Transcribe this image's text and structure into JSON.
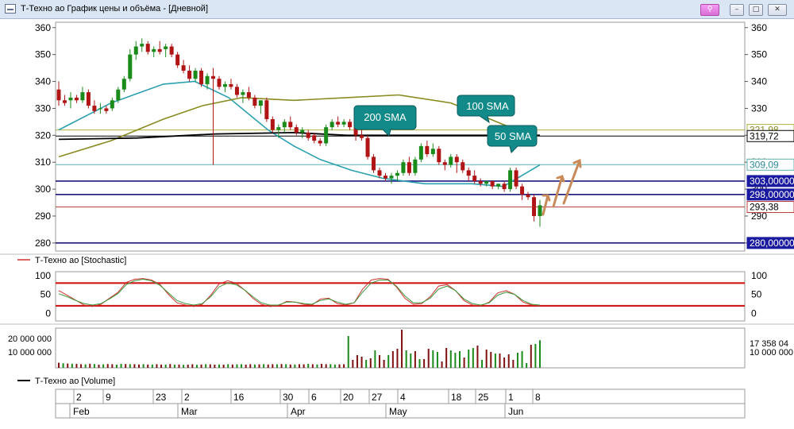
{
  "window": {
    "title": "Т-Техно ао График цены и объёма - [Дневной]",
    "buttons": {
      "pin": "⚲",
      "minimize": "–",
      "maximize": "□",
      "close": "✕"
    }
  },
  "price_pane": {
    "y_ticks": [
      "360",
      "350",
      "340",
      "330",
      "320",
      "310",
      "300",
      "290",
      "280"
    ],
    "labels": {
      "sma200": "200 SMA",
      "sma100": "100 SMA",
      "sma50": "50 SMA"
    },
    "price_tags": [
      "321,98",
      "319,72",
      "309,09",
      "303,00000",
      "298,00000",
      "293,38",
      "280,00000"
    ],
    "colors": {
      "up": "#1a8a1a",
      "down": "#b01414",
      "sma50": "#2aa0b0",
      "sma100": "#8a8a20",
      "sma200": "#000000",
      "level": "#1a1a80",
      "callout": "#138a8a"
    }
  },
  "stochastic_pane": {
    "legend": "Т-Техно ао [Stochastic]",
    "y_ticks": [
      "100",
      "50",
      "0"
    ]
  },
  "volume_pane": {
    "legend": "Т-Техно ао [Volume]",
    "left_ticks": [
      "20 000 000",
      "10 000 000"
    ],
    "right_ticks": [
      "17 358 04",
      "10 000 000"
    ]
  },
  "time_axis": {
    "days": [
      "2",
      "9",
      "23",
      "2",
      "16",
      "30",
      "6",
      "20",
      "27",
      "4",
      "18",
      "25",
      "1",
      "8"
    ],
    "months": [
      "Feb",
      "Mar",
      "Apr",
      "May",
      "Jun"
    ]
  },
  "chart_data": [
    {
      "type": "candlestick",
      "title": "",
      "ylim": [
        277,
        362
      ],
      "yticks": [
        360,
        350,
        340,
        330,
        320,
        310,
        300,
        290,
        280
      ],
      "ohlc": [
        [
          337,
          340,
          331,
          333
        ],
        [
          333,
          335,
          331,
          332
        ],
        [
          333,
          336,
          330,
          334
        ],
        [
          334,
          335,
          332,
          333
        ],
        [
          333,
          338,
          332,
          336
        ],
        [
          336,
          337,
          330,
          331
        ],
        [
          331,
          333,
          328,
          329
        ],
        [
          330,
          332,
          328,
          330
        ],
        [
          330,
          331,
          328,
          329
        ],
        [
          330,
          334,
          329,
          333
        ],
        [
          333,
          338,
          332,
          337
        ],
        [
          337,
          342,
          336,
          341
        ],
        [
          341,
          352,
          340,
          350
        ],
        [
          350,
          355,
          348,
          353
        ],
        [
          353,
          356,
          351,
          354
        ],
        [
          354,
          355,
          350,
          351
        ],
        [
          351,
          353,
          349,
          352
        ],
        [
          352,
          355,
          350,
          351
        ],
        [
          352,
          354,
          349,
          353
        ],
        [
          353,
          354,
          349,
          350
        ],
        [
          350,
          351,
          345,
          346
        ],
        [
          346,
          348,
          343,
          344
        ],
        [
          344,
          346,
          340,
          341
        ],
        [
          341,
          345,
          340,
          344
        ],
        [
          344,
          345,
          338,
          339
        ],
        [
          339,
          343,
          337,
          342
        ],
        [
          342,
          345,
          309,
          341
        ],
        [
          341,
          342,
          337,
          338
        ],
        [
          338,
          340,
          336,
          339
        ],
        [
          339,
          341,
          337,
          338
        ],
        [
          338,
          339,
          334,
          335
        ],
        [
          335,
          337,
          332,
          336
        ],
        [
          336,
          338,
          333,
          334
        ],
        [
          334,
          335,
          330,
          331
        ],
        [
          331,
          333,
          328,
          333
        ],
        [
          333,
          334,
          325,
          326
        ],
        [
          326,
          327,
          321,
          322
        ],
        [
          322,
          324,
          319,
          323
        ],
        [
          323,
          326,
          321,
          325
        ],
        [
          325,
          327,
          322,
          323
        ],
        [
          323,
          324,
          320,
          321
        ],
        [
          321,
          323,
          319,
          322
        ],
        [
          321,
          322,
          318,
          319
        ],
        [
          320,
          321,
          317,
          318
        ],
        [
          318,
          319,
          316,
          317
        ],
        [
          317,
          324,
          316,
          323
        ],
        [
          323,
          326,
          322,
          325
        ],
        [
          325,
          327,
          323,
          324
        ],
        [
          324,
          326,
          323,
          325
        ],
        [
          325,
          326,
          322,
          323
        ],
        [
          323,
          324,
          318,
          320
        ],
        [
          320,
          322,
          318,
          319
        ],
        [
          319,
          320,
          311,
          312
        ],
        [
          312,
          313,
          306,
          307
        ],
        [
          307,
          308,
          304,
          305
        ],
        [
          305,
          306,
          303,
          304
        ],
        [
          304,
          306,
          302,
          305
        ],
        [
          305,
          307,
          303,
          306
        ],
        [
          306,
          311,
          305,
          310
        ],
        [
          310,
          312,
          305,
          306
        ],
        [
          306,
          312,
          305,
          311
        ],
        [
          311,
          317,
          310,
          316
        ],
        [
          316,
          318,
          312,
          313
        ],
        [
          313,
          317,
          312,
          315
        ],
        [
          315,
          316,
          309,
          310
        ],
        [
          310,
          311,
          307,
          309
        ],
        [
          309,
          313,
          308,
          312
        ],
        [
          312,
          313,
          306,
          310
        ],
        [
          310,
          311,
          306,
          307
        ],
        [
          307,
          308,
          303,
          305
        ],
        [
          305,
          307,
          302,
          303
        ],
        [
          303,
          304,
          301,
          302
        ],
        [
          302,
          303,
          301,
          303
        ],
        [
          303,
          303,
          300,
          301
        ],
        [
          301,
          302,
          300,
          302
        ],
        [
          302,
          303,
          299,
          300
        ],
        [
          300,
          308,
          299,
          307
        ],
        [
          307,
          308,
          300,
          301
        ],
        [
          301,
          302,
          296,
          298
        ],
        [
          298,
          299,
          296,
          297
        ],
        [
          297,
          298,
          288,
          290
        ],
        [
          290,
          296,
          286,
          294
        ]
      ],
      "sma50": [
        [
          0,
          322
        ],
        [
          20,
          332
        ],
        [
          40,
          339
        ],
        [
          52,
          340
        ],
        [
          65,
          334
        ],
        [
          80,
          322
        ],
        [
          90,
          316
        ],
        [
          100,
          311
        ],
        [
          112,
          307
        ],
        [
          124,
          304
        ],
        [
          140,
          302
        ],
        [
          158,
          302
        ],
        [
          170,
          301
        ],
        [
          184,
          309
        ]
      ],
      "sma100": [
        [
          0,
          312
        ],
        [
          20,
          318
        ],
        [
          40,
          326
        ],
        [
          55,
          331
        ],
        [
          70,
          334
        ],
        [
          90,
          333
        ],
        [
          110,
          334
        ],
        [
          130,
          335
        ],
        [
          150,
          332
        ],
        [
          175,
          322
        ]
      ],
      "sma200": [
        [
          0,
          318.5
        ],
        [
          30,
          319
        ],
        [
          60,
          320.5
        ],
        [
          90,
          321
        ],
        [
          110,
          320
        ],
        [
          130,
          320
        ],
        [
          160,
          320
        ],
        [
          184,
          320
        ]
      ],
      "levels": [
        321.98,
        319.72,
        309.09,
        303,
        298,
        293.38,
        280
      ]
    },
    {
      "type": "line",
      "title": "Т-Техно ао [Stochastic]",
      "ylim": [
        -20,
        110
      ],
      "bands": [
        80,
        20
      ],
      "series": [
        {
          "values": [
            60,
            48,
            35,
            22,
            18,
            24,
            40,
            55,
            82,
            90,
            92,
            88,
            76,
            50,
            28,
            22,
            18,
            24,
            48,
            78,
            86,
            80,
            62,
            40,
            24,
            18,
            20,
            32,
            30,
            24,
            22,
            38,
            40,
            26,
            22,
            28,
            64,
            88,
            92,
            90,
            70,
            40,
            24,
            26,
            44,
            72,
            76,
            60,
            34,
            22,
            20,
            30,
            54,
            60,
            50,
            30,
            22,
            20
          ]
        },
        {
          "values": [
            52,
            44,
            34,
            26,
            22,
            26,
            38,
            52,
            76,
            86,
            90,
            86,
            74,
            54,
            34,
            26,
            22,
            26,
            44,
            70,
            80,
            76,
            62,
            44,
            28,
            22,
            22,
            30,
            30,
            26,
            24,
            34,
            38,
            30,
            24,
            28,
            56,
            80,
            88,
            88,
            72,
            46,
            28,
            28,
            40,
            64,
            72,
            60,
            38,
            26,
            22,
            28,
            48,
            56,
            50,
            34,
            24,
            22
          ]
        }
      ]
    },
    {
      "type": "bar",
      "title": "Т-Техно ао [Volume]",
      "ylim": [
        0,
        24000000
      ],
      "values": [
        3200000,
        2900000,
        2700000,
        2600000,
        2500000,
        2300000,
        2200000,
        2600000,
        2400000,
        2000000,
        2200000,
        2400000,
        2300000,
        2000000,
        2500000,
        2400000,
        2300000,
        2300000,
        2100000,
        2300000,
        2100000,
        2100000,
        2300000,
        2000000,
        2000000,
        2400000,
        2000000,
        2100000,
        1900000,
        2000000,
        2300000,
        1900000,
        2100000,
        2300000,
        2200000,
        2000000,
        2100000,
        2000000,
        2300000,
        2100000,
        2200000,
        2300000,
        2000000,
        2300000,
        2100000,
        2200000,
        2300000,
        2100000,
        2300000,
        2200000,
        2400000,
        2300000,
        2100000,
        2100000,
        2300000,
        2200000,
        2500000,
        2300000,
        2100000,
        2500000,
        2300000,
        2300000,
        2100000,
        2200000,
        2300000,
        20000000,
        5000000,
        8000000,
        7000000,
        5000000,
        6000000,
        11000000,
        8000000,
        5000000,
        8000000,
        10500000,
        12000000,
        24000000,
        11000000,
        9000000,
        10500000,
        5500000,
        5500000,
        12000000,
        11000000,
        10000000,
        4000000,
        12500000,
        11000000,
        9500000,
        10500000,
        6500000,
        11500000,
        12500000,
        14000000,
        5000000,
        11500000,
        10000000,
        9000000,
        9000000,
        6500000,
        8500000,
        5000000,
        9500000,
        10500000,
        3000000,
        14500000,
        15000000,
        17358040
      ],
      "up_flags": [
        0,
        1,
        0,
        1,
        0,
        0,
        1,
        0,
        1,
        0,
        1,
        0,
        0,
        1,
        1,
        0,
        1,
        0,
        0,
        1,
        0,
        1,
        0,
        0,
        1,
        0,
        1,
        0,
        1,
        0,
        0,
        1,
        0,
        1,
        0,
        0,
        1,
        0,
        1,
        0,
        1,
        1,
        0,
        0,
        1,
        0,
        1,
        0,
        0,
        1,
        0,
        1,
        0,
        1,
        0,
        0,
        1,
        0,
        1,
        0,
        0,
        1,
        1,
        0,
        0,
        1,
        0,
        0,
        0,
        1,
        0,
        1,
        0,
        0,
        1,
        0,
        0,
        0,
        1,
        1,
        0,
        1,
        0,
        0,
        1,
        1,
        0,
        0,
        1,
        1,
        1,
        0,
        1,
        1,
        0,
        1,
        0,
        0,
        1,
        0,
        0,
        0,
        0,
        1,
        1,
        1,
        0,
        1,
        1
      ]
    }
  ]
}
